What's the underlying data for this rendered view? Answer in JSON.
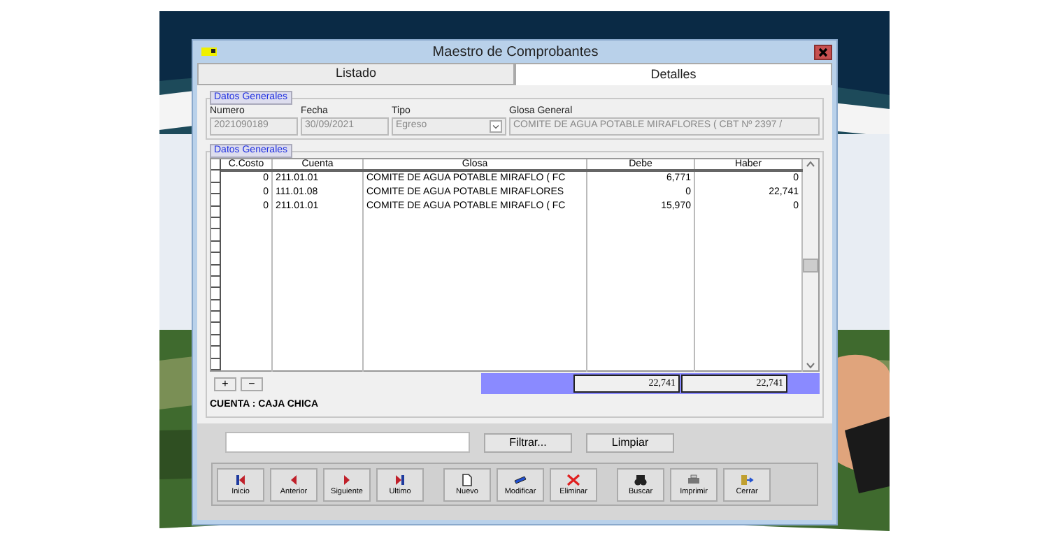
{
  "window": {
    "title": "Maestro de Comprobantes"
  },
  "tabs": [
    {
      "label": "Listado",
      "selected": false
    },
    {
      "label": "Detalles",
      "selected": true
    }
  ],
  "header_group": {
    "legend": "Datos Generales",
    "fields": [
      {
        "label": "Numero",
        "value": "2021090189",
        "kind": "text",
        "disabled": true
      },
      {
        "label": "Fecha",
        "value": "30/09/2021",
        "kind": "text",
        "disabled": true
      },
      {
        "label": "Tipo",
        "value": "Egreso",
        "kind": "dropdown",
        "disabled": true
      },
      {
        "label": "Glosa General",
        "value": "COMITE DE AGUA POTABLE MIRAFLORES ( CBT Nº 2397 /",
        "kind": "text",
        "disabled": true
      }
    ]
  },
  "detail_group": {
    "legend": "Datos Generales",
    "table": {
      "columns": [
        "C.Costo",
        "Cuenta",
        "Glosa",
        "Debe",
        "Haber"
      ],
      "rows": [
        [
          "0",
          "211.01.01",
          "COMITE DE AGUA POTABLE MIRAFLO  ( FC",
          "6,771",
          "0"
        ],
        [
          "0",
          "111.01.08",
          "COMITE DE AGUA POTABLE MIRAFLORES",
          "0",
          "22,741"
        ],
        [
          "0",
          "211.01.01",
          "COMITE DE AGUA POTABLE MIRAFLO  ( FC",
          "15,970",
          "0"
        ]
      ]
    },
    "add_button": "+",
    "remove_button": "−",
    "totals": [
      "22,741",
      "22,741"
    ],
    "account": "CUENTA : CAJA CHICA"
  },
  "filter_buttons": [
    "Filtrar...",
    "Limpiar"
  ],
  "toolbar": [
    {
      "label": "Inicio",
      "kind": "first"
    },
    {
      "label": "Anterior",
      "kind": "prev"
    },
    {
      "label": "Siguiente",
      "kind": "next"
    },
    {
      "label": "Ultimo",
      "kind": "last"
    },
    {
      "label": "Nuevo",
      "kind": "new"
    },
    {
      "label": "Modificar",
      "kind": "modify"
    },
    {
      "label": "Eliminar",
      "kind": "delete"
    },
    {
      "label": "Buscar",
      "kind": "search"
    },
    {
      "label": "Imprimir",
      "kind": "print"
    },
    {
      "label": "Cerrar",
      "kind": "exit"
    }
  ]
}
